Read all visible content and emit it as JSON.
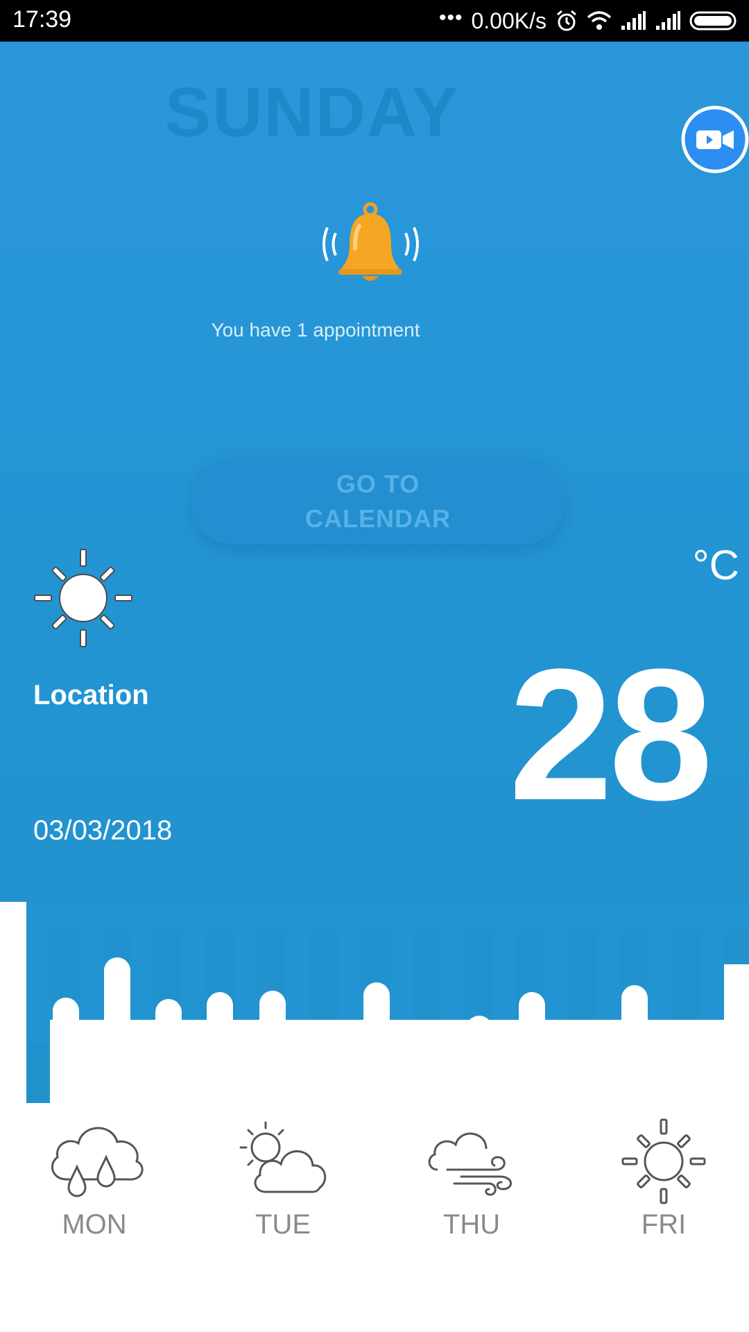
{
  "status_bar": {
    "time": "17:39",
    "dots": "•••",
    "net_speed": "0.00K/s",
    "icons": [
      "alarm-icon",
      "wifi-icon",
      "signal-icon",
      "signal-icon",
      "battery-icon"
    ]
  },
  "header": {
    "day": "SUNDAY"
  },
  "notification": {
    "icon": "bell-icon",
    "text": "You have 1 appointment"
  },
  "calendar_button": {
    "label": "GO TO CALENDAR"
  },
  "weather": {
    "icon": "sun-icon",
    "location": "Location",
    "date": "03/03/2018",
    "temperature": "28",
    "unit": "°C"
  },
  "forecast": [
    {
      "day": "MON",
      "icon": "rain-cloud-icon"
    },
    {
      "day": "TUE",
      "icon": "partly-cloudy-icon"
    },
    {
      "day": "THU",
      "icon": "windy-cloud-icon"
    },
    {
      "day": "FRI",
      "icon": "sun-icon"
    }
  ],
  "colors": {
    "primary_blue": "#2294d1",
    "bell_orange": "#f5a623",
    "video_button": "#2b8ef0",
    "forecast_label": "#8a8a8a"
  }
}
